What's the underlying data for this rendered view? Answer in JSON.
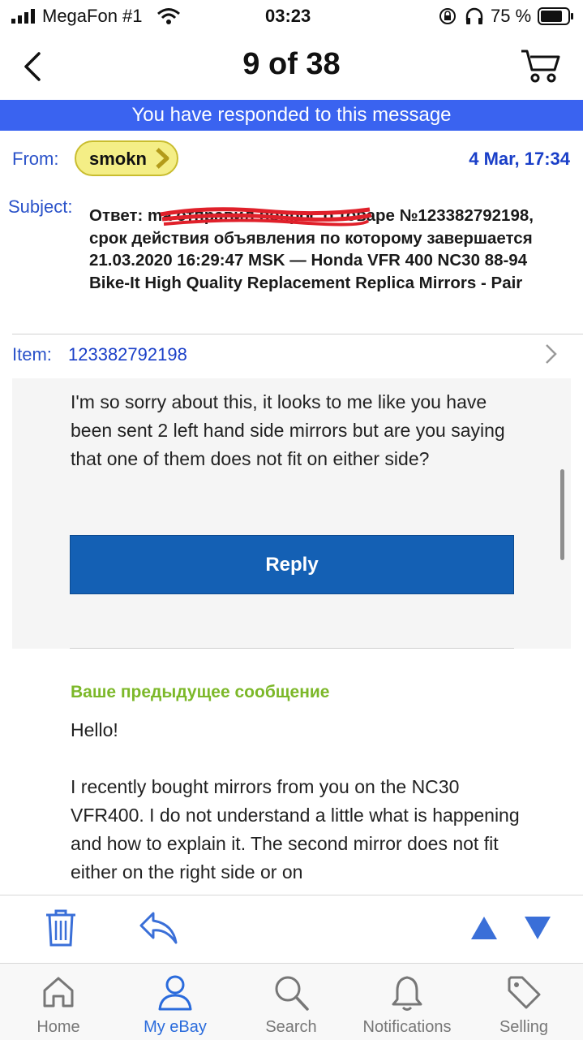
{
  "status_bar": {
    "carrier": "MegaFon #1",
    "time": "03:23",
    "battery": "75 %"
  },
  "nav": {
    "title": "9 of 38"
  },
  "banner": {
    "text": "You have responded to this message"
  },
  "header": {
    "from_label": "From:",
    "from_user": "smokn",
    "date": "4 Mar, 17:34",
    "subject_label": "Subject:",
    "subject_text": "Ответ: ma                     отправил вопрос о товаре №123382792198, срок действия объявления по которому завершается 21.03.2020 16:29:47 MSK — Honda VFR 400 NC30 88-94 Bike-It High Quality Replacement Replica Mirrors - Pair",
    "item_label": "Item:",
    "item_id": "123382792198"
  },
  "message": {
    "body": "I'm so sorry about this, it looks to me like you have been sent 2 left hand side mirrors but are you saying that one of them does not fit on either side?",
    "reply_label": "Reply"
  },
  "previous": {
    "heading": "Ваше предыдущее сообщение",
    "greeting": "Hello!",
    "body": "I recently bought mirrors from you on the NC30 VFR400. I do not understand a little what is happening and how to explain it. The second mirror does not fit either on the right side or on"
  },
  "tabs": [
    {
      "label": "Home",
      "icon": "home-icon"
    },
    {
      "label": "My eBay",
      "icon": "person-icon"
    },
    {
      "label": "Search",
      "icon": "search-icon"
    },
    {
      "label": "Notifications",
      "icon": "bell-icon"
    },
    {
      "label": "Selling",
      "icon": "tag-icon"
    }
  ],
  "colors": {
    "banner": "#3a63f0",
    "link": "#2a52c9",
    "reply_button": "#1460b4",
    "previous_heading": "#7cb829",
    "active_tab": "#2a6bdc"
  }
}
